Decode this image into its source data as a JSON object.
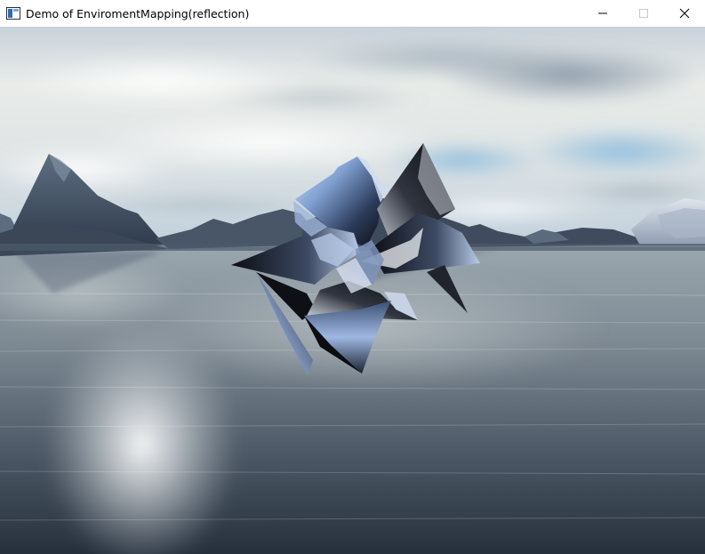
{
  "window": {
    "title": "Demo of EnviromentMapping(reflection)",
    "icon": "app-window-icon",
    "controls": [
      "minimize-icon",
      "maximize-icon",
      "close-icon"
    ]
  },
  "scene": {
    "description_icon": "render-viewport",
    "colors": {
      "sky_top": "#a9b8c6",
      "sky_bright": "#eef0ec",
      "sky_blue": "#7fb2d6",
      "mountain": "#3c4a5e",
      "water_light": "#aab3b8",
      "water_dark": "#1f2a38",
      "metal_light": "#a9c3ea",
      "metal_dark": "#0d0f14"
    }
  }
}
